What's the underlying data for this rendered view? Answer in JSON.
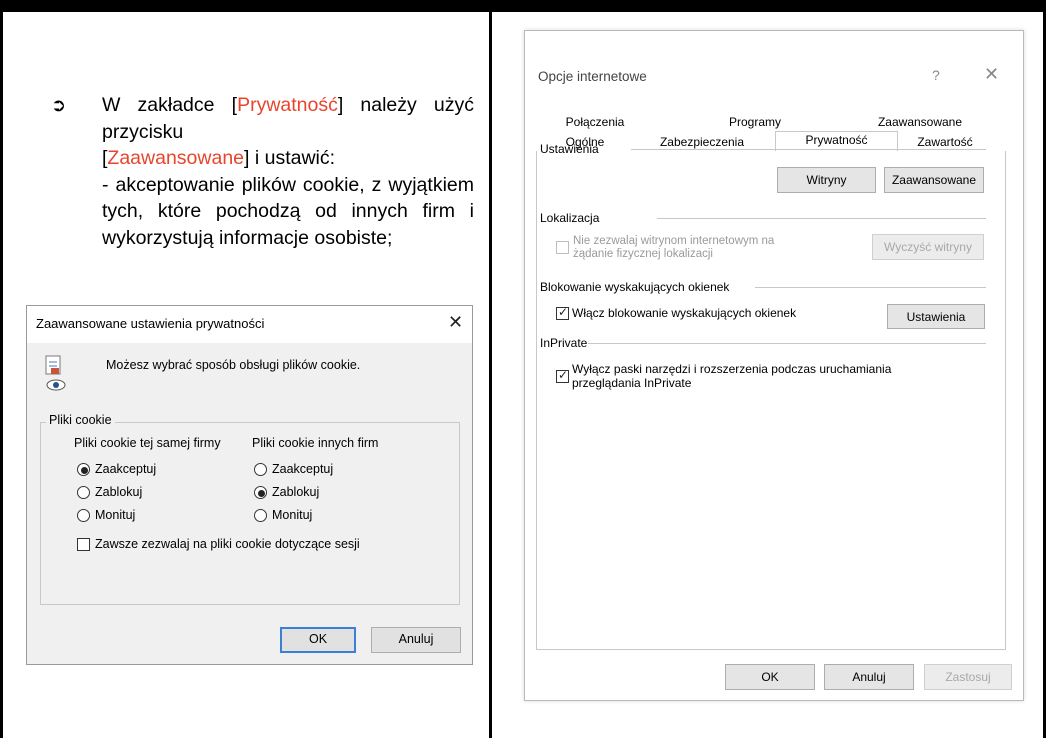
{
  "instructions": {
    "bullet_icon": "arrow-bullet-icon",
    "line1_prefix": "W zakładce [",
    "line1_link": "Prywatność",
    "line1_suffix": "] należy użyć przycisku",
    "line2_link": "Zaawansowane",
    "line2_suffix": "] i ustawić:",
    "line2_bracket": "[",
    "item": "- akceptowanie plików cookie, z wyjątkiem tych, które pochodzą od innych firm i wykorzystują informacje osobiste;"
  },
  "advanced_dialog": {
    "title": "Zaawansowane ustawienia prywatności",
    "close": "✕",
    "intro": "Możesz wybrać sposób obsługi plików cookie.",
    "group_label": "Pliki cookie",
    "first_party": {
      "header": "Pliki cookie tej samej firmy",
      "options": [
        "Zaakceptuj",
        "Zablokuj",
        "Monituj"
      ],
      "selected": "Zaakceptuj"
    },
    "third_party": {
      "header": "Pliki cookie innych firm",
      "options": [
        "Zaakceptuj",
        "Zablokuj",
        "Monituj"
      ],
      "selected": "Zablokuj"
    },
    "session_checkbox": "Zawsze zezwalaj na pliki cookie dotyczące sesji",
    "session_checked": false,
    "ok": "OK",
    "cancel": "Anuluj"
  },
  "internet_options": {
    "title": "Opcje internetowe",
    "help": "?",
    "close": "✕",
    "tabs_row1": [
      "Połączenia",
      "Programy",
      "Zaawansowane"
    ],
    "tabs_row2": [
      "Ogólne",
      "Zabezpieczenia",
      "Prywatność",
      "Zawartość"
    ],
    "active_tab": "Prywatność",
    "settings": {
      "label": "Ustawienia",
      "sites_button": "Witryny",
      "advanced_button": "Zaawansowane"
    },
    "location": {
      "label": "Lokalizacja",
      "checkbox_line1": "Nie zezwalaj witrynom internetowym na",
      "checkbox_line2": "żądanie fizycznej lokalizacji",
      "clear_button": "Wyczyść witryny"
    },
    "popup": {
      "label": "Blokowanie wyskakujących okienek",
      "checkbox": "Włącz blokowanie wyskakujących okienek",
      "checked": true,
      "settings_button": "Ustawienia"
    },
    "inprivate": {
      "label": "InPrivate",
      "checkbox_line1": "Wyłącz paski narzędzi i rozszerzenia podczas uruchamiania",
      "checkbox_line2": "przeglądania InPrivate",
      "checked": true
    },
    "ok": "OK",
    "cancel": "Anuluj",
    "apply": "Zastosuj"
  }
}
